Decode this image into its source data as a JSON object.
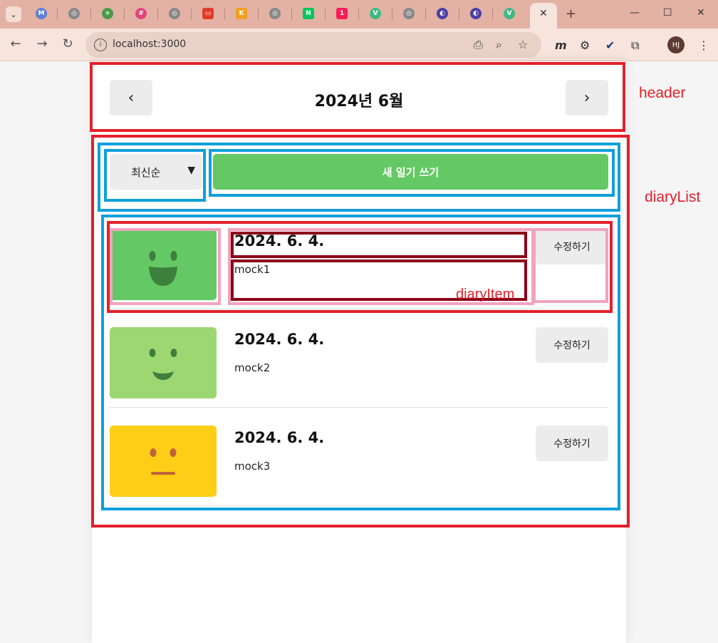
{
  "browser": {
    "url": "localhost:3000",
    "avatar": "HJ",
    "close_tab": "✕",
    "new_tab": "+"
  },
  "header": {
    "prev": "‹",
    "title": "2024년 6월",
    "next": "›"
  },
  "menu": {
    "sort_selected": "최신순",
    "new_button": "새 일기 쓰기"
  },
  "diary": {
    "items": [
      {
        "date": "2024. 6. 4.",
        "content": "mock1",
        "edit": "수정하기",
        "emotion": "very-happy",
        "color": "#64c964"
      },
      {
        "date": "2024. 6. 4.",
        "content": "mock2",
        "edit": "수정하기",
        "emotion": "happy",
        "color": "#9dd772"
      },
      {
        "date": "2024. 6. 4.",
        "content": "mock3",
        "edit": "수정하기",
        "emotion": "neutral",
        "color": "#fdce17"
      }
    ]
  },
  "annotations": {
    "header": "header",
    "diaryList": "diaryList",
    "diaryItem": "diaryItem"
  }
}
